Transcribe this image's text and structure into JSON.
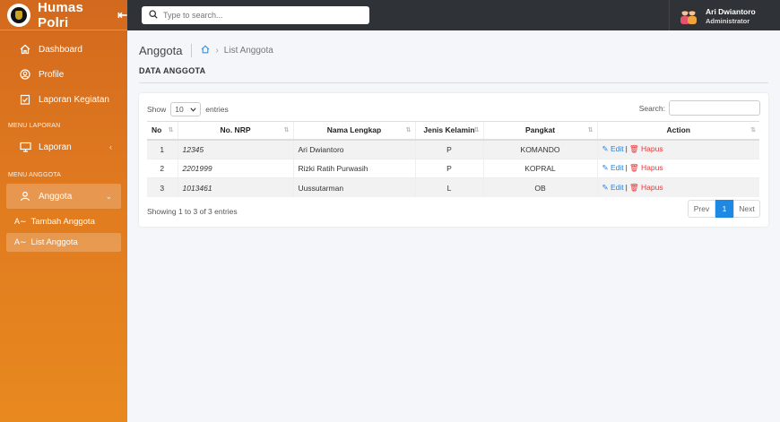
{
  "sidebar": {
    "brand": "Humas Polri",
    "items": [
      {
        "label": "Dashboard"
      },
      {
        "label": "Profile"
      },
      {
        "label": "Laporan Kegiatan"
      }
    ],
    "section_laporan": "MENU LAPORAN",
    "laporan": {
      "label": "Laporan"
    },
    "section_anggota": "MENU ANGGOTA",
    "anggota": {
      "label": "Anggota"
    },
    "sub": [
      {
        "label": "Tambah Anggota"
      },
      {
        "label": "List Anggota"
      }
    ]
  },
  "topbar": {
    "search_placeholder": "Type to search...",
    "user_name": "Ari Dwiantoro",
    "user_role": "Administrator"
  },
  "page": {
    "title": "Anggota",
    "breadcrumb": "List Anggota",
    "section_title": "DATA ANGGOTA"
  },
  "table": {
    "show_label": "Show",
    "length_value": "10",
    "entries_label": "entries",
    "search_label": "Search:",
    "columns": [
      "No",
      "No. NRP",
      "Nama Lengkap",
      "Jenis Kelamin",
      "Pangkat",
      "Action"
    ],
    "rows": [
      {
        "no": "1",
        "nrp": "12345",
        "nama": "Ari Dwiantoro",
        "jk": "P",
        "pangkat": "KOMANDO"
      },
      {
        "no": "2",
        "nrp": "2201999",
        "nama": "Rizki Ratih Purwasih",
        "jk": "P",
        "pangkat": "KOPRAL"
      },
      {
        "no": "3",
        "nrp": "1013461",
        "nama": "Uussutarman",
        "jk": "L",
        "pangkat": "OB"
      }
    ],
    "edit_label": "Edit",
    "delete_label": "Hapus",
    "info": "Showing 1 to 3 of 3 entries",
    "pagination": {
      "prev": "Prev",
      "current": "1",
      "next": "Next"
    }
  }
}
